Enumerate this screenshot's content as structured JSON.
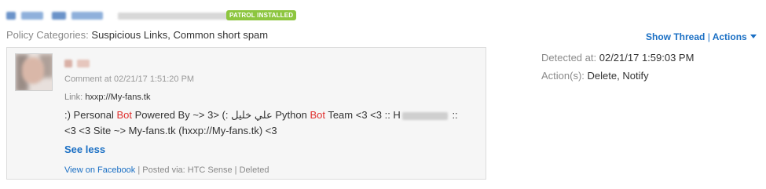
{
  "header": {
    "account_name": "",
    "badge": "PATROL INSTALLED"
  },
  "policy": {
    "label": "Policy Categories:",
    "values": "Suspicious Links, Common short spam"
  },
  "thread_controls": {
    "show_thread": "Show Thread",
    "separator": "|",
    "actions": "Actions"
  },
  "detection": {
    "detected_label": "Detected at:",
    "detected_value": "02/21/17 1:59:03 PM",
    "actions_label": "Action(s):",
    "actions_value": "Delete, Notify"
  },
  "comment": {
    "comment_at": "Comment at 02/21/17 1:51:20 PM",
    "link_label": "Link:",
    "link_value": "hxxp://My-fans.tk",
    "msg_part1": ":) Personal ",
    "msg_bot1": "Bot",
    "msg_part2": " Powered By ~> 3> (: علي خليل Python ",
    "msg_bot2": "Bot",
    "msg_part3": " Team <3 <3 :: H",
    "msg_part4": " ::",
    "msg_line2": "<3 <3 Site ~> My-fans.tk (hxxp://My-fans.tk) <3",
    "see_less": "See less",
    "view_on_facebook": "View on Facebook",
    "footer_rest": " | Posted via: HTC Sense | Deleted"
  },
  "colors": {
    "accent": "#1a6fc4",
    "badge_green": "#8dc63f",
    "highlight_red": "#e0302e"
  }
}
